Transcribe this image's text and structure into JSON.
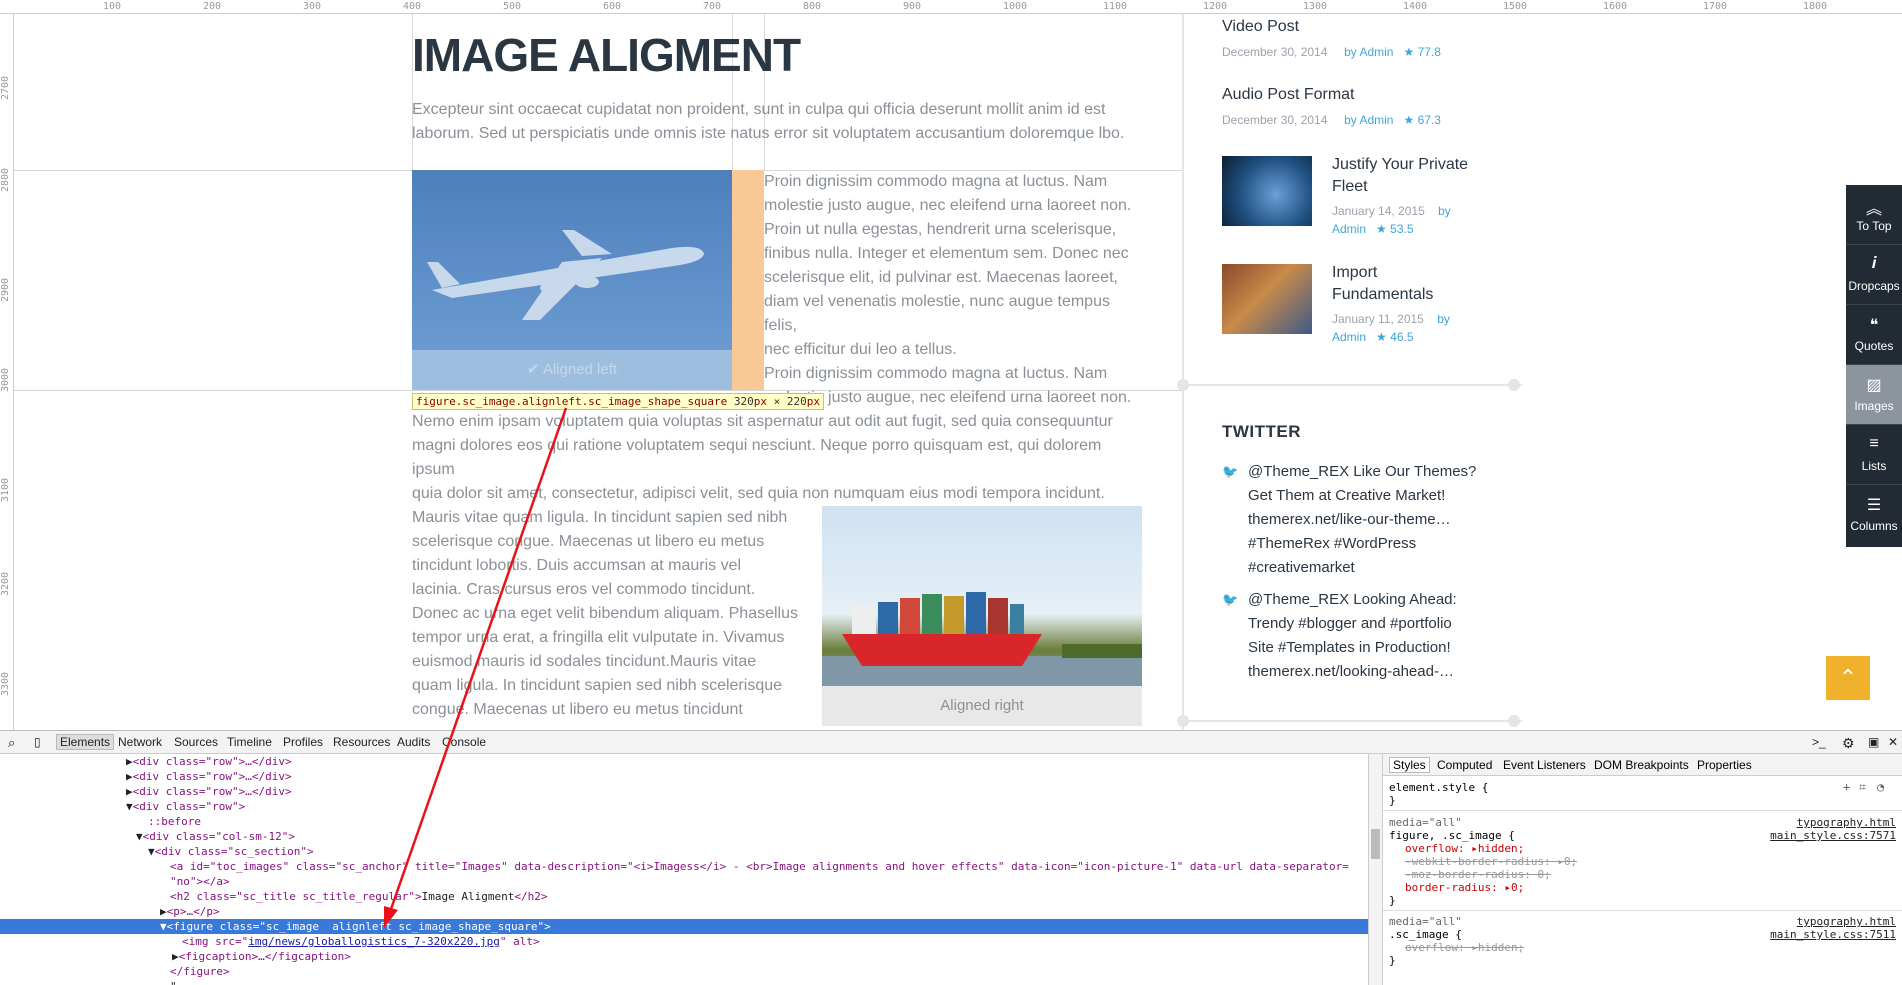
{
  "ruler": {
    "top_ticks": [
      "100",
      "200",
      "300",
      "400",
      "500",
      "600",
      "700",
      "800",
      "900",
      "1000",
      "1100",
      "1200",
      "1300",
      "1400",
      "1500",
      "1600",
      "1700",
      "1800"
    ],
    "left_ticks": [
      "2700",
      "2800",
      "2900",
      "3000",
      "3100",
      "3200",
      "3300"
    ]
  },
  "page": {
    "title": "IMAGE ALIGMENT",
    "intro": "Excepteur sint occaecat cupidatat non proident, sunt in culpa qui officia deserunt mollit anim id est laborum. Sed ut perspiciatis unde omnis iste natus error sit voluptatem accusantium doloremque lbo.",
    "fig1_caption": "Aligned left",
    "side_para_lines": [
      "Proin dignissim commodo magna at luctus. Nam",
      "molestie justo augue, nec eleifend urna laoreet non.",
      "Proin ut nulla egestas, hendrerit urna scelerisque,",
      "finibus nulla. Integer et elementum sem. Donec nec",
      "scelerisque elit, id pulvinar est. Maecenas laoreet,",
      "diam vel venenatis molestie, nunc augue tempus felis,",
      "nec efficitur dui leo a tellus.",
      "Proin dignissim commodo magna at luctus. Nam",
      "molestie justo augue, nec eleifend urna laoreet non."
    ],
    "tooltip_selector": "figure.sc_image.alignleft.sc_image_shape_square",
    "tooltip_w": "320",
    "tooltip_px1": "px",
    "tooltip_x": " × ",
    "tooltip_h": "220",
    "tooltip_px2": "px",
    "para2_lines": [
      "Nemo enim ipsam voluptatem quia voluptas sit aspernatur aut odit aut fugit, sed quia consequuntur",
      "magni dolores eos qui ratione voluptatem sequi nesciunt. Neque porro quisquam est, qui dolorem ipsum",
      "quia dolor sit amet, consectetur, adipisci velit, sed quia non numquam eius modi tempora incidunt."
    ],
    "para3_lines": [
      "Mauris vitae quam ligula. In tincidunt sapien sed nibh",
      "scelerisque congue. Maecenas ut libero eu metus",
      "tincidunt lobortis. Duis accumsan at mauris vel",
      "lacinia. Cras cursus eros vel commodo tincidunt.",
      "Donec ac urna eget velit bibendum aliquam. Phasellus",
      "tempor urna erat, a fringilla elit vulputate in. Vivamus",
      "euismod mauris id sodales tincidunt.Mauris vitae",
      "quam ligula. In tincidunt sapien sed nibh scelerisque",
      "congue. Maecenas ut libero eu metus tincidunt"
    ],
    "fig2_caption": "Aligned right"
  },
  "sidebar": {
    "posts": [
      {
        "title": "Video Post",
        "date": "December 30, 2014",
        "by": "by",
        "author": "Admin",
        "rating": "77.8"
      },
      {
        "title": "Audio Post Format",
        "date": "December 30, 2014",
        "by": "by",
        "author": "Admin",
        "rating": "67.3"
      },
      {
        "title1": "Justify Your Private",
        "title2": "Fleet",
        "date": "January 14, 2015",
        "by": "by",
        "author": "Admin",
        "rating": "53.5"
      },
      {
        "title1": "Import",
        "title2": "Fundamentals",
        "date": "January 11, 2015",
        "by": "by",
        "author": "Admin",
        "rating": "46.5"
      }
    ],
    "twitter_heading": "TWITTER",
    "tweets": [
      {
        "lines": [
          "@Theme_REX Like Our Themes?",
          "Get Them at Creative Market!",
          "themerex.net/like-our-theme…",
          "#ThemeRex #WordPress",
          "#creativemarket"
        ]
      },
      {
        "lines": [
          "@Theme_REX Looking Ahead:",
          "Trendy #blogger and #portfolio",
          "Site #Templates in Production!",
          "themerex.net/looking-ahead-…"
        ]
      }
    ]
  },
  "fixed_menu": [
    {
      "label": "To Top",
      "icon": "chevrons-up-icon",
      "glyph": "︽"
    },
    {
      "label": "Dropcaps",
      "icon": "info-icon",
      "glyph": "𝒊"
    },
    {
      "label": "Quotes",
      "icon": "quote-icon",
      "glyph": "❝"
    },
    {
      "label": "Images",
      "icon": "image-icon",
      "glyph": "▨"
    },
    {
      "label": "Lists",
      "icon": "list-icon",
      "glyph": "≡"
    },
    {
      "label": "Columns",
      "icon": "columns-icon",
      "glyph": "☰"
    }
  ],
  "devtools": {
    "tabs": [
      "Elements",
      "Network",
      "Sources",
      "Timeline",
      "Profiles",
      "Resources",
      "Audits",
      "Console"
    ],
    "code": {
      "row1": "<div class=\"row\">…</div>",
      "row2": "<div class=\"row\">…</div>",
      "row3": "<div class=\"row\">…</div>",
      "row_open": "<div class=\"row\">",
      "before": "::before",
      "col": "<div class=\"col-sm-12\">",
      "section": "<div class=\"sc_section\">",
      "anchor": "<a id=\"toc_images\" class=\"sc_anchor\" title=\"Images\" data-description=\"<i>Imagess</i> - <br>Image alignments and hover effects\" data-icon=\"icon-picture-1\" data-url data-separator=",
      "anchor2": "\"no\"></a>",
      "h2_open": "<h2 class=\"sc_title sc_title_regular\">",
      "h2_text": "Image Aligment",
      "h2_close": "</h2>",
      "p": "<p>…</p>",
      "figure": "<figure class=\"sc_image  alignleft sc_image_shape_square\">",
      "img_pre": "<img src=\"",
      "img_src": "img/news/globallogistics_7-320x220.jpg",
      "img_post": "\" alt>",
      "figcaption": "<figcaption>…</figcaption>",
      "figure_close": "</figure>",
      "last": "\""
    },
    "side_tabs": [
      "Styles",
      "Computed",
      "Event Listeners",
      "DOM Breakpoints",
      "Properties"
    ],
    "styles": {
      "element_style": "element.style {",
      "close": "}",
      "media": "media=\"all\"",
      "rule1_sel": "figure, .sc_image {",
      "rule1_src1": "typography.html",
      "rule1_src2": "main_style.css:7571",
      "rule1_p1": "overflow: ▸hidden;",
      "rule1_p2": "-webkit-border-radius: ▸0;",
      "rule1_p3": "-moz-border-radius: 0;",
      "rule1_p4": "border-radius: ▸0;",
      "rule2_sel": ".sc_image {",
      "rule2_src1": "typography.html",
      "rule2_src2": "main_style.css:7511",
      "rule2_p1": "overflow: ▸hidden;"
    }
  },
  "colors": {
    "accent": "#f0b22d",
    "link": "#3fa6d8",
    "selection": "#3879d9",
    "title": "#2a3642"
  }
}
